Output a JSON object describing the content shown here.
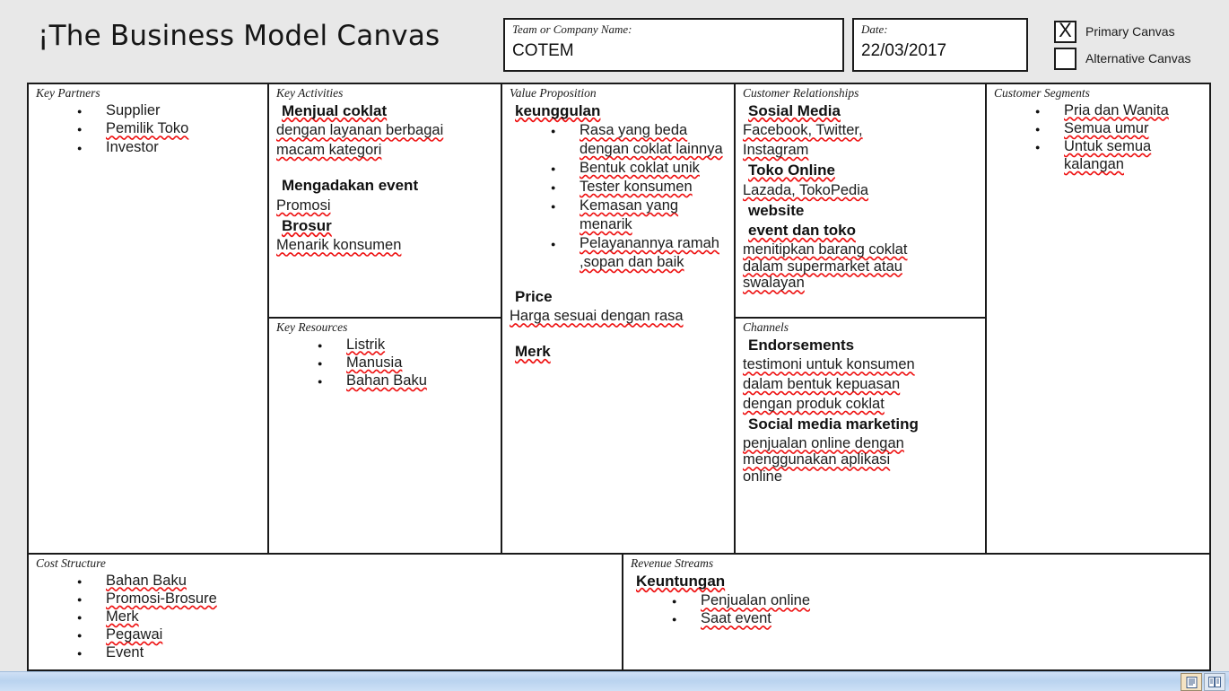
{
  "header": {
    "title": "¡The Business Model Canvas",
    "team_label": "Team or Company Name:",
    "team_value": "COTEM",
    "date_label": "Date:",
    "date_value": "22/03/2017",
    "primary_canvas_label": "Primary Canvas",
    "primary_canvas_mark": "X",
    "alternative_canvas_label": "Alternative Canvas",
    "alternative_canvas_mark": ""
  },
  "blocks": {
    "key_partners": {
      "title": "Key Partners",
      "items": [
        "Supplier",
        "Pemilik Toko",
        "Investor"
      ]
    },
    "key_activities": {
      "title": "Key Activities",
      "h1": "Menjual coklat",
      "l1a": "dengan layanan berbagai",
      "l1b": "macam kategori",
      "h2": "Mengadakan event",
      "l2": "Promosi",
      "h3": "Brosur",
      "l3": "Menarik konsumen"
    },
    "key_resources": {
      "title": "Key Resources",
      "items": [
        "Listrik",
        "Manusia",
        "Bahan Baku"
      ]
    },
    "value_proposition": {
      "title": "Value Proposition",
      "h1": "keunggulan",
      "items": [
        "Rasa yang beda dengan coklat lainnya",
        "Bentuk coklat unik",
        "Tester konsumen",
        "Kemasan yang menarik",
        "Pelayanannya ramah ,sopan dan baik"
      ],
      "h2": "Price",
      "l2": "Harga sesuai dengan rasa",
      "h3": "Merk"
    },
    "customer_relationships": {
      "title": "Customer Relationships",
      "h1": "Sosial Media",
      "l1a": "Facebook, Twitter,",
      "l1b": "Instagram",
      "h2": "Toko Online",
      "l2": "Lazada, TokoPedia",
      "h3": "website",
      "h4": "event dan toko",
      "l4a": "menitipkan barang coklat",
      "l4b": "dalam supermarket atau",
      "l4c": "swalayan"
    },
    "channels": {
      "title": "Channels",
      "h1": "Endorsements",
      "l1a": "testimoni untuk konsumen",
      "l1b": "dalam bentuk kepuasan",
      "l1c": "dengan produk coklat",
      "h2": "Social media marketing",
      "l2a": "penjualan online dengan",
      "l2b": "menggunakan aplikasi",
      "l2c": "online"
    },
    "customer_segments": {
      "title": "Customer Segments",
      "items": [
        "Pria dan Wanita",
        "Semua umur",
        "Untuk semua kalangan"
      ]
    },
    "cost_structure": {
      "title": "Cost Structure",
      "items": [
        "Bahan Baku",
        "Promosi-Brosure",
        "Merk",
        "Pegawai",
        "Event"
      ]
    },
    "revenue_streams": {
      "title": "Revenue Streams",
      "h1": "Keuntungan",
      "items": [
        "Penjualan online",
        "Saat event"
      ]
    }
  },
  "statusbar": {
    "view_print_layout_icon": "print-layout-icon",
    "view_reading_icon": "reading-view-icon"
  }
}
